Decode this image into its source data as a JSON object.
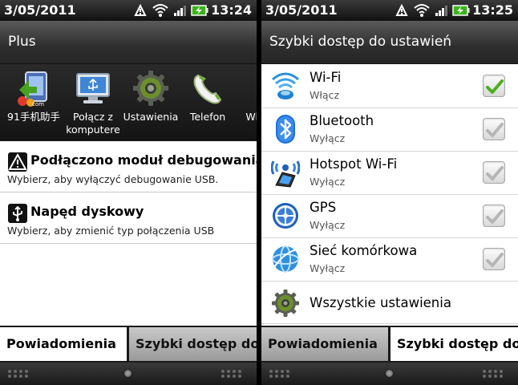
{
  "left": {
    "status": {
      "date": "3/05/2011",
      "time": "13:24"
    },
    "title": "Plus",
    "apps": [
      {
        "label": "91手机助手",
        "icon": "91-assistant-icon"
      },
      {
        "label_line1": "Połącz z",
        "label_line2": "komputere",
        "icon": "usb-computer-icon"
      },
      {
        "label": "Ustawienia",
        "icon": "settings-gear-icon"
      },
      {
        "label": "Telefon",
        "icon": "phone-icon"
      },
      {
        "label_line1": "Wiad",
        "label_line2": "k",
        "icon": "messages-icon"
      }
    ],
    "notifications": [
      {
        "title": "Podłączono moduł debugowania U",
        "subtitle": "Wybierz, aby wyłączyć debugowanie USB.",
        "icon": "warning-icon"
      },
      {
        "title": "Napęd dyskowy",
        "subtitle": "Wybierz, aby zmienić typ połączenia USB",
        "icon": "usb-icon"
      }
    ],
    "tabs": {
      "active": "Powiadomienia",
      "inactive": "Szybki dostęp do"
    }
  },
  "right": {
    "status": {
      "date": "3/05/2011",
      "time": "13:25"
    },
    "title": "Szybki dostęp do ustawień",
    "settings": [
      {
        "title": "Wi-Fi",
        "subtitle": "Włącz",
        "checked": true,
        "icon": "wifi-icon"
      },
      {
        "title": "Bluetooth",
        "subtitle": "Wyłącz",
        "checked": false,
        "icon": "bluetooth-icon"
      },
      {
        "title": "Hotspot Wi-Fi",
        "subtitle": "Wyłącz",
        "checked": false,
        "icon": "hotspot-icon"
      },
      {
        "title": "GPS",
        "subtitle": "Wyłącz",
        "checked": false,
        "icon": "gps-icon"
      },
      {
        "title": "Sieć komórkowa",
        "subtitle": "Wyłącz",
        "checked": false,
        "icon": "mobile-network-icon"
      }
    ],
    "all_settings": "Wszystkie ustawienia",
    "tabs": {
      "active": "Powiadomienia",
      "inactive": "Szybki dostęp do"
    }
  },
  "colors": {
    "check_green": "#4caf1f",
    "check_grey": "#b5b5b5",
    "bluetooth_blue": "#1f6fd6",
    "wifi_blue": "#2a8fe0"
  }
}
